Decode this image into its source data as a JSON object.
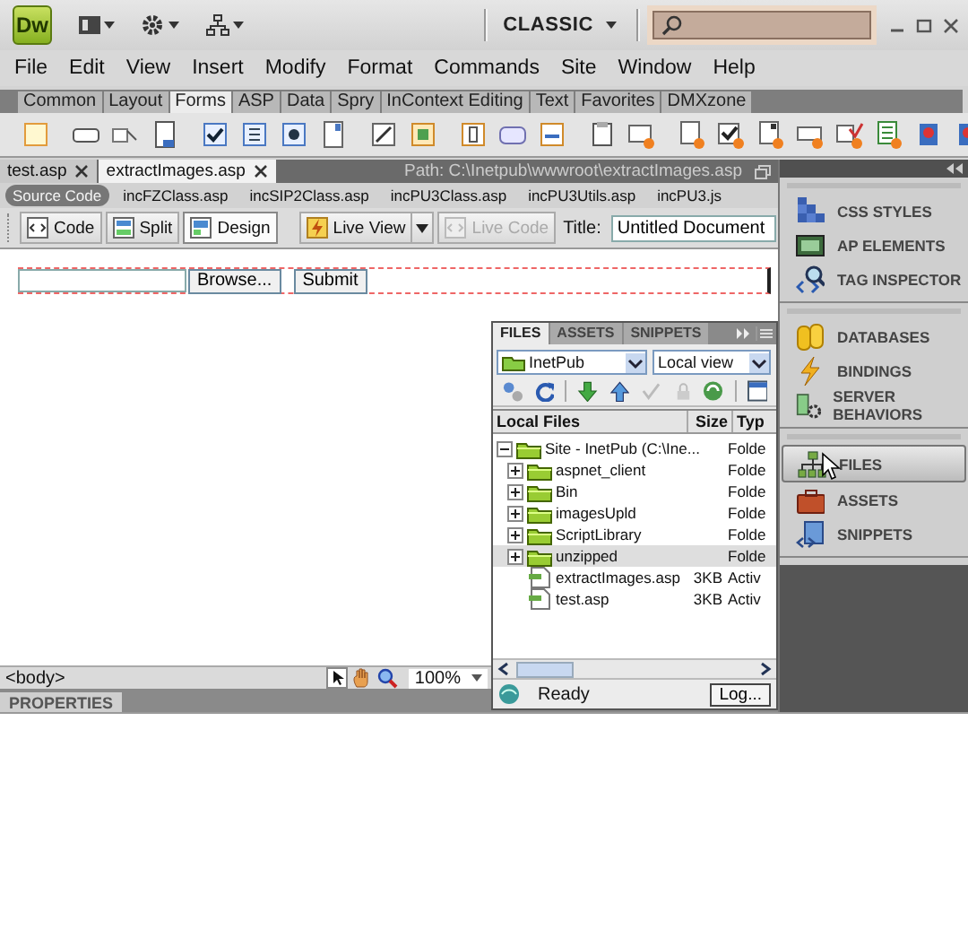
{
  "app_bar": {
    "logo": "Dw",
    "workspace": "CLASSIC"
  },
  "menu": [
    "File",
    "Edit",
    "View",
    "Insert",
    "Modify",
    "Format",
    "Commands",
    "Site",
    "Window",
    "Help"
  ],
  "insert_tabs": [
    {
      "label": "Common",
      "selected": false
    },
    {
      "label": "Layout",
      "selected": false
    },
    {
      "label": "Forms",
      "selected": true
    },
    {
      "label": "ASP",
      "selected": false
    },
    {
      "label": "Data",
      "selected": false
    },
    {
      "label": "Spry",
      "selected": false
    },
    {
      "label": "InContext Editing",
      "selected": false
    },
    {
      "label": "Text",
      "selected": false
    },
    {
      "label": "Favorites",
      "selected": false
    },
    {
      "label": "DMXzone",
      "selected": false
    }
  ],
  "document_tabs": [
    {
      "label": "test.asp",
      "selected": false
    },
    {
      "label": "extractImages.asp",
      "selected": true
    }
  ],
  "path": "Path:  C:\\Inetpub\\wwwroot\\extractImages.asp",
  "related_files": [
    {
      "label": "Source Code",
      "selected": true
    },
    {
      "label": "incFZClass.asp",
      "selected": false
    },
    {
      "label": "incSIP2Class.asp",
      "selected": false
    },
    {
      "label": "incPU3Class.asp",
      "selected": false
    },
    {
      "label": "incPU3Utils.asp",
      "selected": false
    },
    {
      "label": "incPU3.js",
      "selected": false
    }
  ],
  "view_buttons": [
    {
      "label": "Code",
      "selected": false
    },
    {
      "label": "Split",
      "selected": false
    },
    {
      "label": "Design",
      "selected": true
    }
  ],
  "live_view": "Live View",
  "live_code": {
    "label": "Live Code",
    "disabled": true
  },
  "title_label": "Title:",
  "title_value": "Untitled Document",
  "form": {
    "browse": "Browse...",
    "submit": "Submit"
  },
  "status_bar": {
    "tag": "<body>",
    "zoom": "100%"
  },
  "properties_tab": "PROPERTIES",
  "panel_groups": [
    [
      {
        "label": "CSS STYLES",
        "kind": "css",
        "selected": false
      },
      {
        "label": "AP ELEMENTS",
        "kind": "ap",
        "selected": false
      },
      {
        "label": "TAG INSPECTOR",
        "kind": "tag",
        "selected": false
      }
    ],
    [
      {
        "label": "DATABASES",
        "kind": "db",
        "selected": false
      },
      {
        "label": "BINDINGS",
        "kind": "bind",
        "selected": false
      },
      {
        "label": "SERVER BEHAVIORS",
        "kind": "server",
        "selected": false
      }
    ],
    [
      {
        "label": "FILES",
        "kind": "files",
        "selected": true
      },
      {
        "label": "ASSETS",
        "kind": "assets",
        "selected": false
      },
      {
        "label": "SNIPPETS",
        "kind": "snippets",
        "selected": false
      }
    ]
  ],
  "files_panel": {
    "tabs": [
      {
        "label": "FILES",
        "selected": true
      },
      {
        "label": "ASSETS",
        "selected": false
      },
      {
        "label": "SNIPPETS",
        "selected": false
      }
    ],
    "site": "InetPub",
    "view": "Local view",
    "columns": [
      "Local Files",
      "Size",
      "Typ"
    ],
    "tree": [
      {
        "name": "Site - InetPub (C:\\Ine...",
        "type": "Folde",
        "kind": "folder",
        "expanded": true,
        "selected": false,
        "children": [
          {
            "name": "aspnet_client",
            "type": "Folde",
            "kind": "folder",
            "expanded": false,
            "selected": false
          },
          {
            "name": "Bin",
            "type": "Folde",
            "kind": "folder",
            "expanded": false,
            "selected": false
          },
          {
            "name": "imagesUpld",
            "type": "Folde",
            "kind": "folder",
            "expanded": false,
            "selected": false
          },
          {
            "name": "ScriptLibrary",
            "type": "Folde",
            "kind": "folder",
            "expanded": false,
            "selected": false
          },
          {
            "name": "unzipped",
            "type": "Folde",
            "kind": "folder",
            "expanded": false,
            "selected": true
          },
          {
            "name": "extractImages.asp",
            "size": "3KB",
            "type": "Activ",
            "kind": "file",
            "selected": false
          },
          {
            "name": "test.asp",
            "size": "3KB",
            "type": "Activ",
            "kind": "file",
            "selected": false
          }
        ]
      }
    ],
    "status": "Ready",
    "log_button": "Log..."
  }
}
